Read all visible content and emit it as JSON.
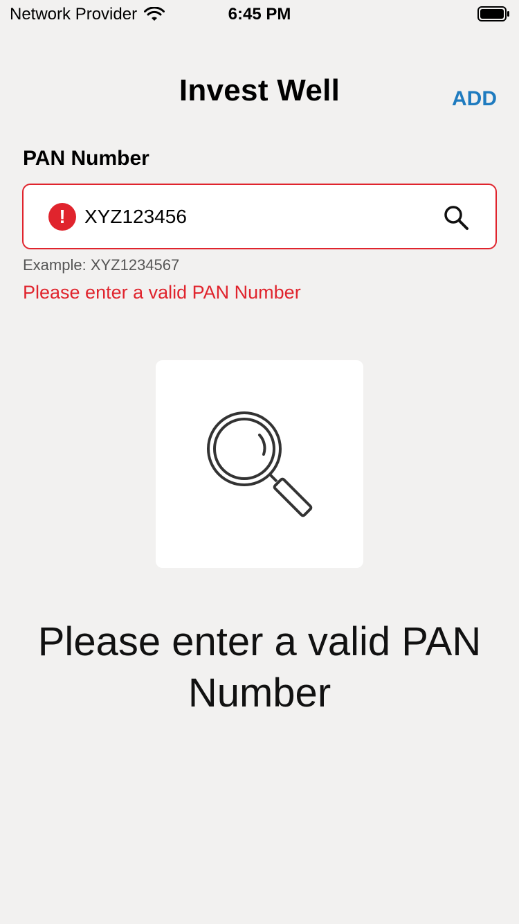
{
  "status_bar": {
    "carrier": "Network Provider",
    "time": "6:45 PM",
    "wifi_icon": "wifi-icon",
    "battery_icon": "battery-icon"
  },
  "nav": {
    "title": "Invest Well",
    "add_label": "ADD"
  },
  "form": {
    "label": "PAN Number",
    "value": "XYZ123456",
    "placeholder": "",
    "hint": "Example: XYZ1234567",
    "error": "Please enter a valid PAN Number",
    "error_icon": "alert-circle-icon",
    "search_icon": "search-icon"
  },
  "empty_state": {
    "icon": "magnifier-icon",
    "message": "Please enter a valid PAN Number"
  },
  "colors": {
    "accent": "#1f7bbf",
    "error": "#e0242d",
    "background": "#f2f1f0"
  }
}
